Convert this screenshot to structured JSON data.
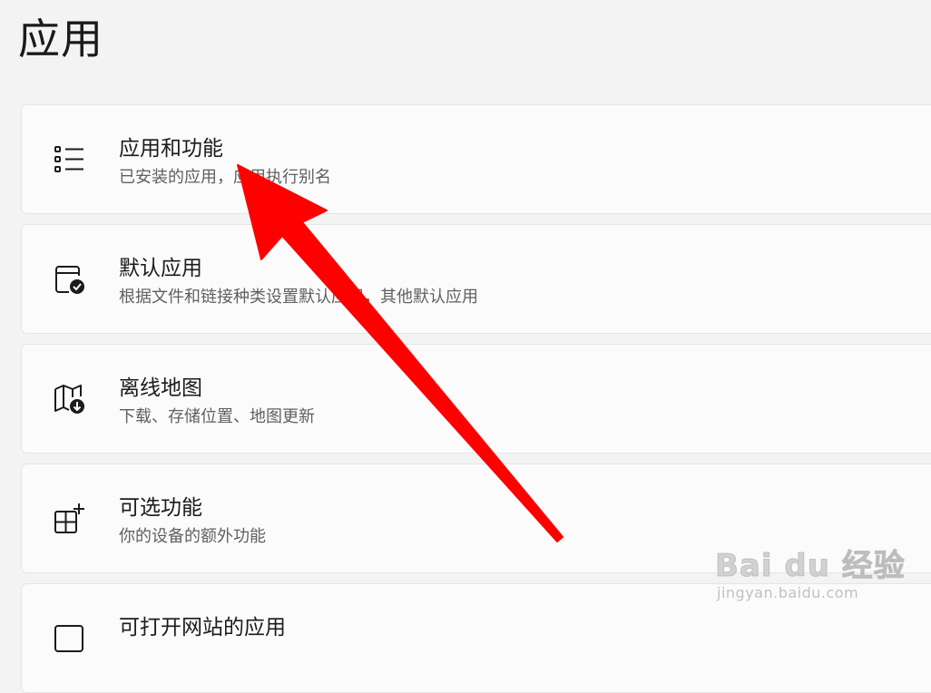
{
  "page": {
    "title": "应用"
  },
  "cards": [
    {
      "icon": "list-icon",
      "title": "应用和功能",
      "subtitle": "已安装的应用，应用执行别名"
    },
    {
      "icon": "default-apps-icon",
      "title": "默认应用",
      "subtitle": "根据文件和链接种类设置默认应用，其他默认应用"
    },
    {
      "icon": "offline-maps-icon",
      "title": "离线地图",
      "subtitle": "下载、存储位置、地图更新"
    },
    {
      "icon": "optional-features-icon",
      "title": "可选功能",
      "subtitle": "你的设备的额外功能"
    },
    {
      "icon": "open-with-website-icon",
      "title": "可打开网站的应用",
      "subtitle": ""
    }
  ],
  "annotation": {
    "arrow_color": "#ff0000"
  },
  "watermark": {
    "main": "Bai du 经验",
    "sub": "jingyan.baidu.com"
  }
}
